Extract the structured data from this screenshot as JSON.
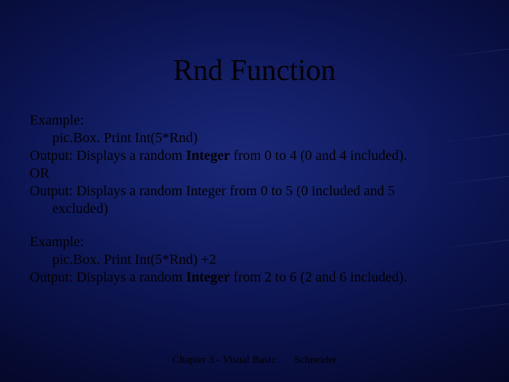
{
  "title": "Rnd Function",
  "block1": {
    "l1": "Example:",
    "l2": "pic.Box. Print Int(5*Rnd)",
    "l3_pre": "Output: Displays a random ",
    "l3_bold": "Integer",
    "l3_post": " from 0 to 4 (0 and 4 included).",
    "l4": "OR",
    "l5": "Output: Displays a random Integer from 0 to 5 (0 included and 5",
    "l6": "excluded)"
  },
  "block2": {
    "l1": "Example:",
    "l2": "pic.Box. Print Int(5*Rnd) +2",
    "l3_pre": "Output: Displays a random ",
    "l3_bold": "Integer",
    "l3_post": " from 2 to 6 (2 and 6 included)."
  },
  "footer": {
    "left": "Chapter 3 - Visual Basic",
    "right": "Schneider"
  }
}
